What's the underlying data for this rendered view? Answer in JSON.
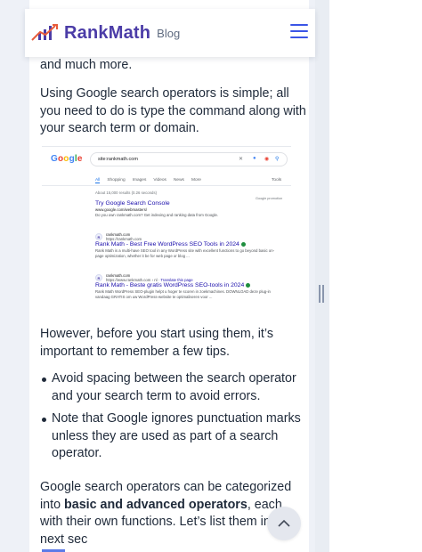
{
  "header": {
    "logo_text": "RankMath",
    "logo_sub": "Blog",
    "menu_icon": "hamburger-menu-icon"
  },
  "article": {
    "p_fragment": "and much more.",
    "p_operators": "Using Google search operators is simple; all you need to do is type the command along with your search term or domain.",
    "p_however": "However, before you start using them, it’s important to remember a few tips.",
    "tips": [
      "Avoid spacing between the search operator and your search term to avoid errors.",
      "Note that Google ignores punctuation marks unless they are used as part of a search operator."
    ],
    "p_categorized_pre": "Google search operators can be categorized into ",
    "p_categorized_bold": "basic and advanced operators",
    "p_categorized_post": ", each with their own functions. Let’s list them in the next sec"
  },
  "screenshot": {
    "google_logo": "Google",
    "query": "site:rankmath.com",
    "tabs": [
      "All",
      "Shopping",
      "Images",
      "Videos",
      "News",
      "More"
    ],
    "tools": "Tools",
    "stats": "About 15,000 results (0.26 seconds)",
    "gp_note": "Google promotion",
    "results": [
      {
        "title": "Try Google Search Console",
        "url": "www.google.com/webmasters/",
        "desc": "Do you own rankmath.com? Get indexing and ranking data from Google."
      },
      {
        "site": "rankmath.com",
        "site_url": "https://rankmath.com",
        "title": "Rank Math - Best Free WordPress SEO Tools in 2024",
        "desc": "Rank Math is a multi-have SEO tool in any WordPress site with excellent functions to go beyond basic on-page optimization, whether it be for web page or blog ..."
      },
      {
        "site": "rankmath.com",
        "site_url": "https://www.rankmath.com › nl",
        "translate": "Translate this page",
        "title": "Rank Math - Beste gratis WordPress SEO-tools in 2024",
        "desc": "Rank Math WordPress SEO-plugin helpt u hoger te scoren in zoekmachines. DOWNLOAD deze plug-in vandaag GRATIS om uw WordPress-website te optimaliseren voor ..."
      }
    ]
  },
  "back_to_top_icon": "chevron-up-icon"
}
